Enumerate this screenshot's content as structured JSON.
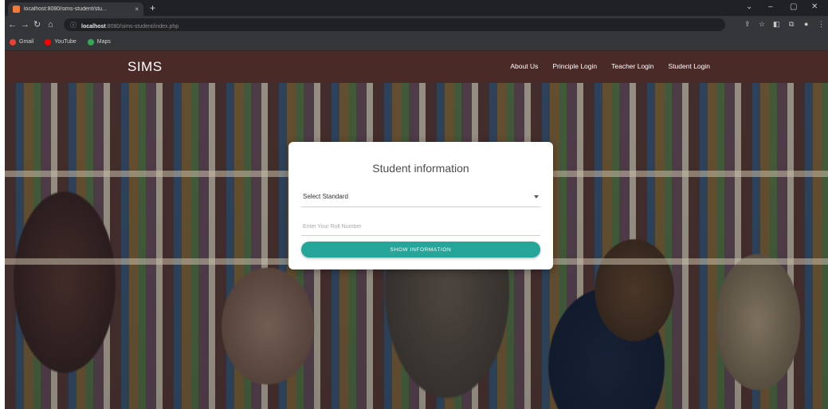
{
  "browser": {
    "tab_title": "localhost:8080/sims-student/stu...",
    "tab_close": "×",
    "new_tab": "+",
    "address_host": "localhost",
    "address_path": ":8080/sims-student/index.php",
    "bookmarks": [
      {
        "label": "Gmail",
        "icon": "gmail-icon",
        "color": "#ea4335"
      },
      {
        "label": "YouTube",
        "icon": "youtube-icon",
        "color": "#ff0000"
      },
      {
        "label": "Maps",
        "icon": "maps-icon",
        "color": "#34a853"
      }
    ]
  },
  "navbar": {
    "brand": "SIMS",
    "links": [
      "About Us",
      "Principle Login",
      "Teacher Login",
      "Student Login"
    ],
    "background": "#4a2a27"
  },
  "form": {
    "title": "Student information",
    "select_value": "Select Standard",
    "roll_placeholder": "Enter Your Roll Number",
    "button_label": "SHOW INFORMATION",
    "accent": "#26a69a"
  }
}
